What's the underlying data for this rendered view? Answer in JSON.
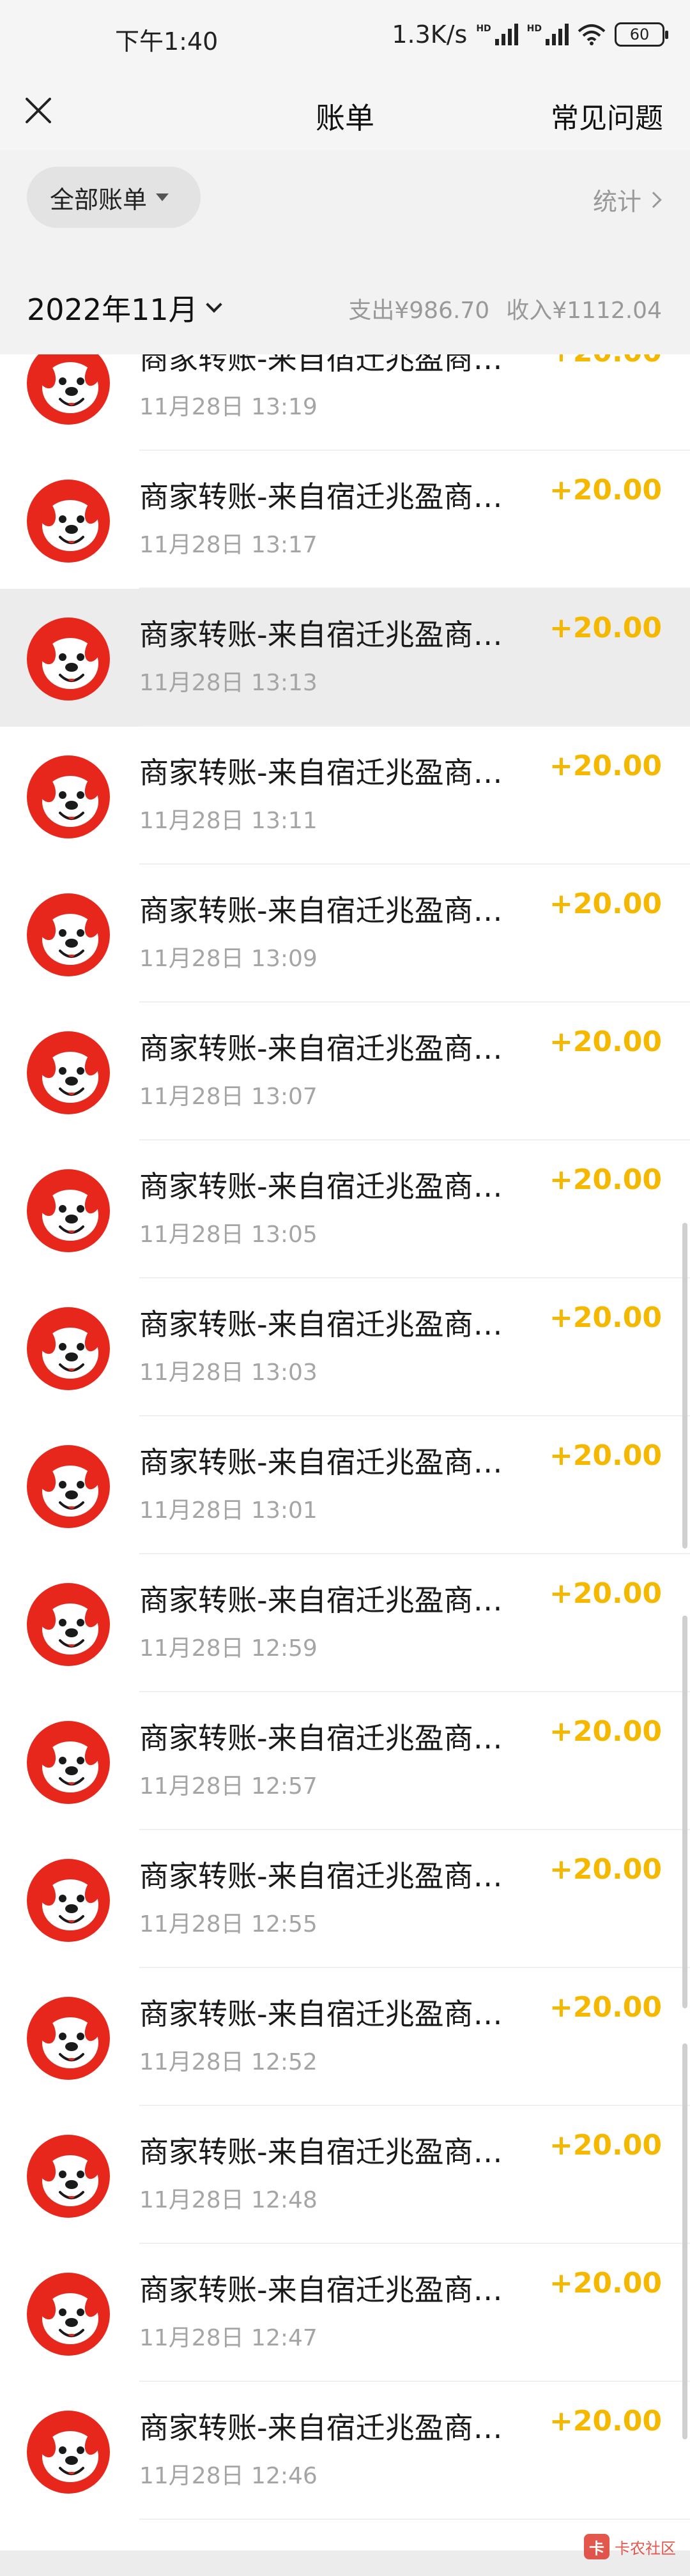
{
  "status_bar": {
    "time": "下午1:40",
    "network_speed": "1.3K/s",
    "battery": "60"
  },
  "header": {
    "title": "账单",
    "right_link": "常见问题"
  },
  "filter": {
    "all_bills_label": "全部账单",
    "stats_label": "统计"
  },
  "month_bar": {
    "month": "2022年11月",
    "expense": "支出¥986.70",
    "income": "收入¥1112.04"
  },
  "transactions": [
    {
      "title": "商家转账-来自宿迁兆盈商务有限公司",
      "time": "11月28日 13:19",
      "amount": "+20.00"
    },
    {
      "title": "商家转账-来自宿迁兆盈商务有限公司",
      "time": "11月28日 13:17",
      "amount": "+20.00"
    },
    {
      "title": "商家转账-来自宿迁兆盈商务有限公司",
      "time": "11月28日 13:13",
      "amount": "+20.00"
    },
    {
      "title": "商家转账-来自宿迁兆盈商务有限公司",
      "time": "11月28日 13:11",
      "amount": "+20.00"
    },
    {
      "title": "商家转账-来自宿迁兆盈商务有限公司",
      "time": "11月28日 13:09",
      "amount": "+20.00"
    },
    {
      "title": "商家转账-来自宿迁兆盈商务有限公司",
      "time": "11月28日 13:07",
      "amount": "+20.00"
    },
    {
      "title": "商家转账-来自宿迁兆盈商务有限公司",
      "time": "11月28日 13:05",
      "amount": "+20.00"
    },
    {
      "title": "商家转账-来自宿迁兆盈商务有限公司",
      "time": "11月28日 13:03",
      "amount": "+20.00"
    },
    {
      "title": "商家转账-来自宿迁兆盈商务有限公司",
      "time": "11月28日 13:01",
      "amount": "+20.00"
    },
    {
      "title": "商家转账-来自宿迁兆盈商务有限公司",
      "time": "11月28日 12:59",
      "amount": "+20.00"
    },
    {
      "title": "商家转账-来自宿迁兆盈商务有限公司",
      "time": "11月28日 12:57",
      "amount": "+20.00"
    },
    {
      "title": "商家转账-来自宿迁兆盈商务有限公司",
      "time": "11月28日 12:55",
      "amount": "+20.00"
    },
    {
      "title": "商家转账-来自宿迁兆盈商务有限公司",
      "time": "11月28日 12:52",
      "amount": "+20.00"
    },
    {
      "title": "商家转账-来自宿迁兆盈商务有限公司",
      "time": "11月28日 12:48",
      "amount": "+20.00"
    },
    {
      "title": "商家转账-来自宿迁兆盈商务有限公司",
      "time": "11月28日 12:47",
      "amount": "+20.00"
    },
    {
      "title": "商家转账-来自宿迁兆盈商务有限公司",
      "time": "11月28日 12:46",
      "amount": "+20.00"
    }
  ],
  "watermark": {
    "name": "卡农社区"
  },
  "colors": {
    "amount": "#f5b800",
    "avatar_red": "#e8271c",
    "header_bg": "#f5f5f5"
  }
}
